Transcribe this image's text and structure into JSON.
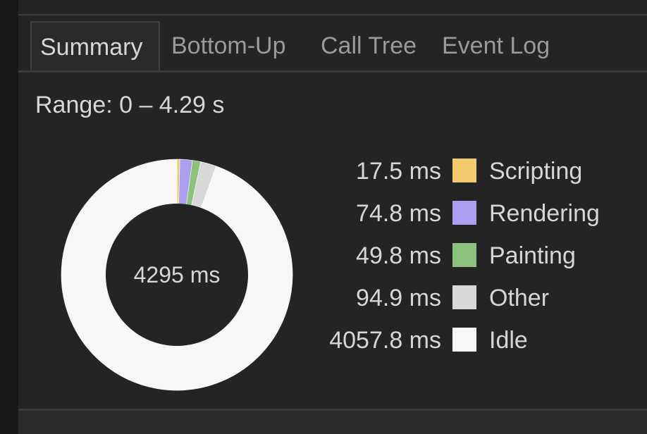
{
  "tabs": [
    {
      "label": "Summary",
      "active": true
    },
    {
      "label": "Bottom-Up",
      "active": false
    },
    {
      "label": "Call Tree",
      "active": false
    },
    {
      "label": "Event Log",
      "active": false
    }
  ],
  "range_text": "Range: 0 – 4.29 s",
  "total_text": "4295 ms",
  "chart_data": {
    "type": "pie",
    "categories": [
      "Scripting",
      "Rendering",
      "Painting",
      "Other",
      "Idle"
    ],
    "values": [
      17.5,
      74.8,
      49.8,
      94.9,
      4057.8
    ],
    "value_labels": [
      "17.5 ms",
      "74.8 ms",
      "49.8 ms",
      "94.9 ms",
      "4057.8 ms"
    ],
    "colors": [
      "#f2c96b",
      "#ad9ff0",
      "#8cc37c",
      "#d8d8d8",
      "#f7f7f7"
    ],
    "title": "",
    "center_label": "4295 ms"
  }
}
